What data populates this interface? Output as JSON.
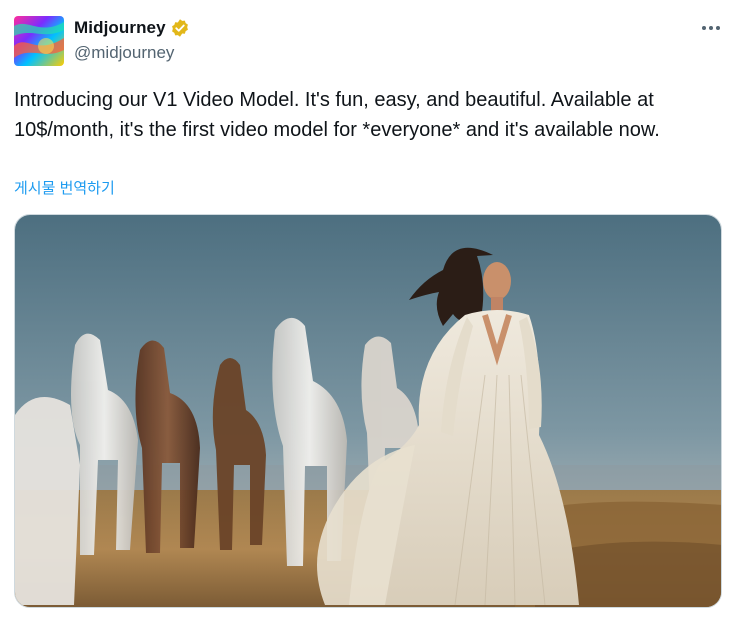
{
  "post": {
    "display_name": "Midjourney",
    "handle": "@midjourney",
    "text": "Introducing our V1 Video Model. It's fun, easy, and beautiful. Available at 10$/month, it's the first video model for *everyone* and it's available now.",
    "translate_label": "게시물 번역하기"
  },
  "icons": {
    "verified": "verified-badge-icon",
    "more": "more-options-icon"
  },
  "colors": {
    "link": "#1d9bf0",
    "verified_badge": "#e2b719",
    "secondary_text": "#536471"
  }
}
